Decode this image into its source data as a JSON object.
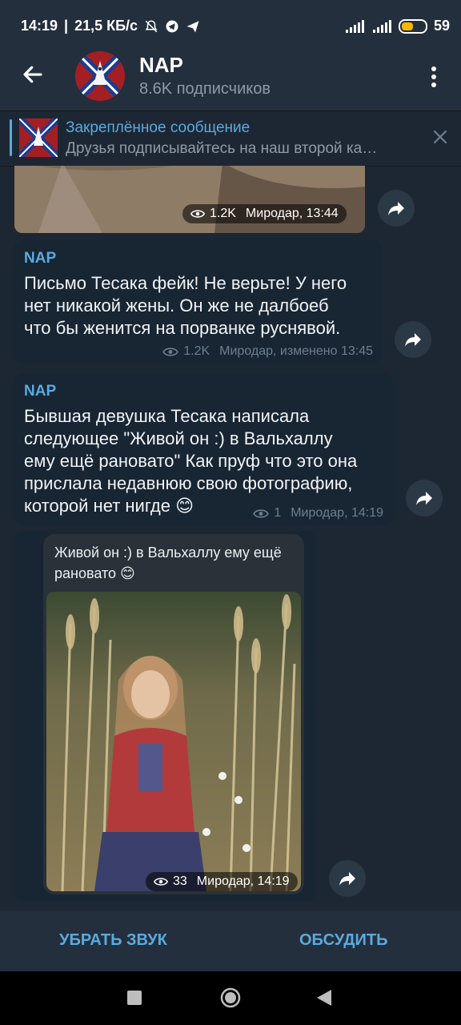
{
  "status": {
    "time": "14:19",
    "speed": "21,5 КБ/с",
    "battery": "59",
    "battery_fill": 0.59
  },
  "header": {
    "title": "NAP",
    "subtitle": "8.6K подписчиков"
  },
  "pinned": {
    "title": "Закреплённое сообщение",
    "text": "Друзья подписывайтесь на наш второй ка…"
  },
  "messages": [
    {
      "views": "1.2K",
      "meta": "Миродар, 13:44"
    },
    {
      "author": "NAP",
      "text": "Письмо Тесака фейк! Не верьте! У него\nнет никакой жены. Он же не далбоеб\nчто бы женится на порванке руснявой.",
      "views": "1.2K",
      "meta": "Миродар, изменено 13:45"
    },
    {
      "author": "NAP",
      "text": "Бывшая девушка Тесака написала\nследующее \"Живой он :) в Вальхаллу\nему ещё рановато\" Как пруф что это она\nприслала недавнюю свою фотографию,\nкоторой нет нигде 😊",
      "views": "1",
      "meta": "Миродар, 14:19"
    },
    {
      "caption": "Живой он :) в Вальхаллу ему ещё рановато 😊",
      "views": "33",
      "meta": "Миродар, 14:19"
    }
  ],
  "bottom": {
    "mute_label": "УБРАТЬ ЗВУК",
    "discuss_label": "ОБСУДИТЬ"
  },
  "colors": {
    "accent": "#5aaadf",
    "background": "#1d2733",
    "bubble": "#182533",
    "header": "#242f3d"
  }
}
